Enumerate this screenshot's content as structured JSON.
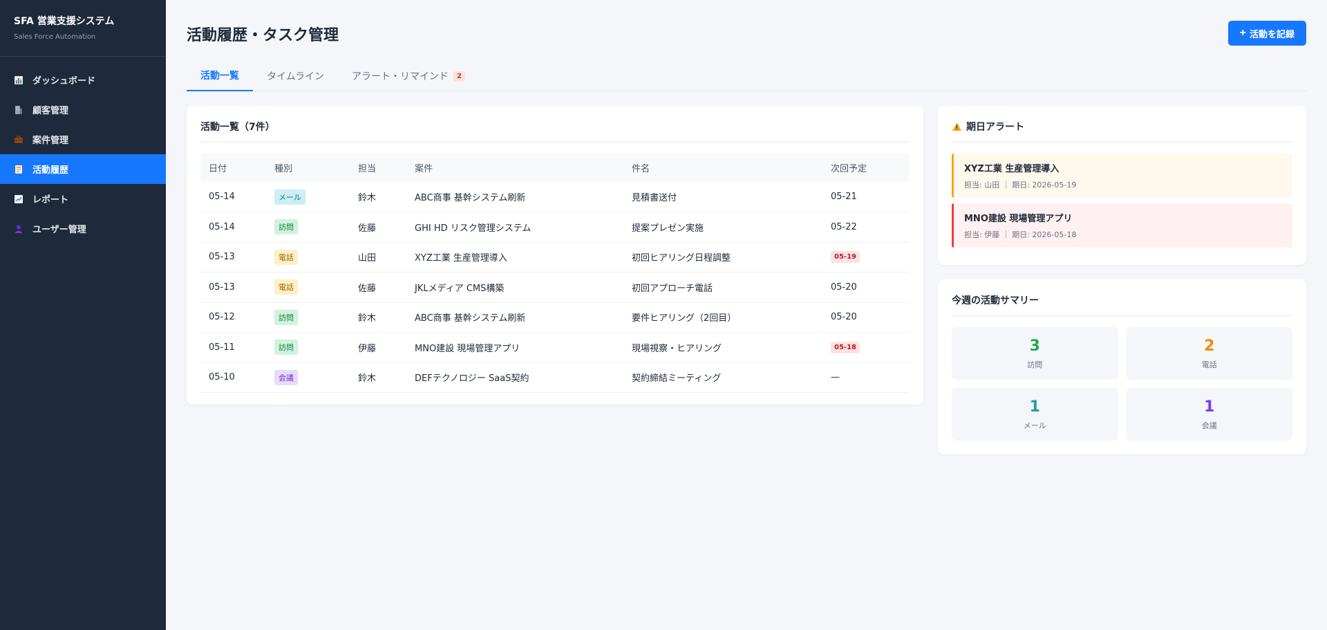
{
  "sidebar": {
    "title": "SFA 営業支援システム",
    "subtitle": "Sales Force Automation",
    "items": [
      {
        "label": "ダッシュボード",
        "icon": "chart-icon",
        "active": false
      },
      {
        "label": "顧客管理",
        "icon": "building-icon",
        "active": false
      },
      {
        "label": "案件管理",
        "icon": "briefcase-icon",
        "active": false
      },
      {
        "label": "活動履歴",
        "icon": "memo-icon",
        "active": true
      },
      {
        "label": "レポート",
        "icon": "trend-icon",
        "active": false
      },
      {
        "label": "ユーザー管理",
        "icon": "user-icon",
        "active": false
      }
    ]
  },
  "header": {
    "title": "活動履歴・タスク管理",
    "record_button": "活動を記録",
    "record_button_icon": "+"
  },
  "tabs": [
    {
      "label": "活動一覧",
      "active": true
    },
    {
      "label": "タイムライン",
      "active": false
    },
    {
      "label": "アラート・リマインド",
      "active": false,
      "badge": "2"
    }
  ],
  "activity_list": {
    "title": "活動一覧（7件）",
    "columns": [
      "日付",
      "種別",
      "担当",
      "案件",
      "件名",
      "次回予定"
    ],
    "rows": [
      {
        "date": "05-14",
        "type": "メール",
        "owner": "鈴木",
        "deal": "ABC商事 基幹システム刷新",
        "subject": "見積書送付",
        "next": "05-21",
        "next_alert": false
      },
      {
        "date": "05-14",
        "type": "訪問",
        "owner": "佐藤",
        "deal": "GHI HD リスク管理システム",
        "subject": "提案プレゼン実施",
        "next": "05-22",
        "next_alert": false
      },
      {
        "date": "05-13",
        "type": "電話",
        "owner": "山田",
        "deal": "XYZ工業 生産管理導入",
        "subject": "初回ヒアリング日程調整",
        "next": "05-19",
        "next_alert": true
      },
      {
        "date": "05-13",
        "type": "電話",
        "owner": "佐藤",
        "deal": "JKLメディア CMS構築",
        "subject": "初回アプローチ電話",
        "next": "05-20",
        "next_alert": false
      },
      {
        "date": "05-12",
        "type": "訪問",
        "owner": "鈴木",
        "deal": "ABC商事 基幹システム刷新",
        "subject": "要件ヒアリング（2回目）",
        "next": "05-20",
        "next_alert": false
      },
      {
        "date": "05-11",
        "type": "訪問",
        "owner": "伊藤",
        "deal": "MNO建設 現場管理アプリ",
        "subject": "現場視察・ヒアリング",
        "next": "05-18",
        "next_alert": true
      },
      {
        "date": "05-10",
        "type": "会議",
        "owner": "鈴木",
        "deal": "DEFテクノロジー SaaS契約",
        "subject": "契約締結ミーティング",
        "next": "—",
        "next_alert": false
      }
    ]
  },
  "type_colors": {
    "メール": {
      "bg": "#cdeef3",
      "fg": "#0e7490"
    },
    "訪問": {
      "bg": "#d1f2dc",
      "fg": "#15803d"
    },
    "電話": {
      "bg": "#fdf0c6",
      "fg": "#a16207"
    },
    "会議": {
      "bg": "#e6dcf7",
      "fg": "#6d28d9"
    }
  },
  "alerts": {
    "title": "期日アラート",
    "icon": "warning-icon",
    "items": [
      {
        "title": "XYZ工業 生産管理導入",
        "meta": "担当: 山田 ｜ 期日: 2026-05-19",
        "level": "warning",
        "border": "#f5a623",
        "bg": "#fff8ec"
      },
      {
        "title": "MNO建設 現場管理アプリ",
        "meta": "担当: 伊藤 ｜ 期日: 2026-05-18",
        "level": "danger",
        "border": "#e53e3e",
        "bg": "#fff1f1"
      }
    ]
  },
  "summary": {
    "title": "今週の活動サマリー",
    "items": [
      {
        "value": "3",
        "label": "訪問",
        "color": "#22a55a"
      },
      {
        "value": "2",
        "label": "電話",
        "color": "#f08c00"
      },
      {
        "value": "1",
        "label": "メール",
        "color": "#17a2a2"
      },
      {
        "value": "1",
        "label": "会議",
        "color": "#7c3aed"
      }
    ]
  },
  "colors": {
    "accent": "#1677ff",
    "sidebar_bg": "#1e293b"
  }
}
